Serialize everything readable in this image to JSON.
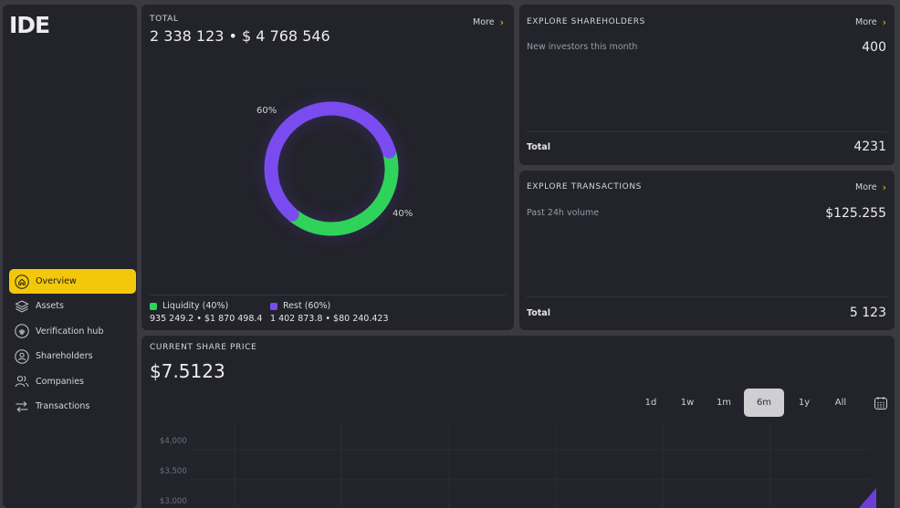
{
  "app": {
    "logo": "IDE"
  },
  "sidebar": {
    "items": [
      {
        "label": "Overview",
        "icon": "home-icon",
        "active": true
      },
      {
        "label": "Assets",
        "icon": "layers-icon",
        "active": false
      },
      {
        "label": "Verification hub",
        "icon": "fingerprint-icon",
        "active": false
      },
      {
        "label": "Shareholders",
        "icon": "user-circle-icon",
        "active": false
      },
      {
        "label": "Companies",
        "icon": "users-icon",
        "active": false
      },
      {
        "label": "Transactions",
        "icon": "transfer-arrows-icon",
        "active": false
      }
    ]
  },
  "total_card": {
    "label": "TOTAL",
    "more": "More",
    "value": "2 338 123 • $ 4 768 546",
    "rest_pct": "60%",
    "liquidity_pct": "40%",
    "legend": [
      {
        "label": "Liquidity (40%)",
        "color": "#2fd35a",
        "detail": "935 249.2  •  $1 870 498.4"
      },
      {
        "label": "Rest (60%)",
        "color": "#7a4cf0",
        "detail": "1 402 873.8  •  $80 240.423"
      }
    ]
  },
  "chart_data": {
    "type": "pie",
    "categories": [
      "Liquidity",
      "Rest"
    ],
    "values": [
      40,
      60
    ],
    "colors": [
      "#2fd35a",
      "#7a4cf0"
    ]
  },
  "shareholders_card": {
    "label": "EXPLORE SHAREHOLDERS",
    "more": "More",
    "metric_label": "New investors this month",
    "metric_value": "400",
    "total_label": "Total",
    "total_value": "4231"
  },
  "transactions_card": {
    "label": "EXPLORE TRANSACTIONS",
    "more": "More",
    "metric_label": "Past 24h volume",
    "metric_value": "$125.255",
    "total_label": "Total",
    "total_value": "5 123"
  },
  "share_price": {
    "label": "CURRENT SHARE PRICE",
    "value": "$7.5123",
    "ranges": [
      "1d",
      "1w",
      "1m",
      "6m",
      "1y",
      "All"
    ],
    "active_range": "6m",
    "y_ticks": [
      "$4,000",
      "$3,500",
      "$3,000"
    ]
  }
}
